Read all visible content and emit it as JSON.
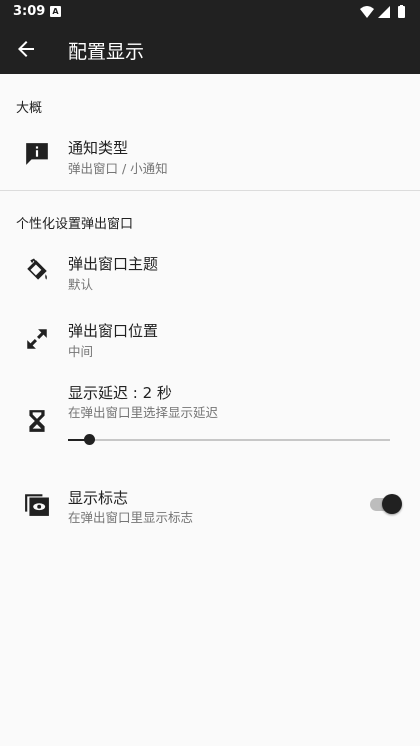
{
  "status_bar": {
    "time": "3:09",
    "notification_glyph": "A"
  },
  "app_bar": {
    "title": "配置显示",
    "back_icon": "arrow-back-icon"
  },
  "sections": [
    {
      "header": "大概"
    },
    {
      "header": "个性化设置弹出窗口"
    }
  ],
  "items": {
    "notification_type": {
      "title": "通知类型",
      "summary": "弹出窗口 / 小通知",
      "icon": "announcement-icon"
    },
    "popup_theme": {
      "title": "弹出窗口主题",
      "summary": "默认",
      "icon": "paint-bucket-icon"
    },
    "popup_position": {
      "title": "弹出窗口位置",
      "summary": "中间",
      "icon": "arrows-diagonal-icon"
    },
    "display_delay": {
      "title": "显示延迟 : 2 秒",
      "summary": "在弹出窗口里选择显示延迟",
      "icon": "hourglass-icon",
      "slider_value": 0.035
    },
    "show_logo": {
      "title": "显示标志",
      "summary": "在弹出窗口里显示标志",
      "icon": "logo-eye-icon",
      "toggle_on": true
    }
  },
  "colors": {
    "bar": "#212121",
    "background": "#fafafa",
    "accent": "#212121",
    "secondary_text": "#757575"
  }
}
